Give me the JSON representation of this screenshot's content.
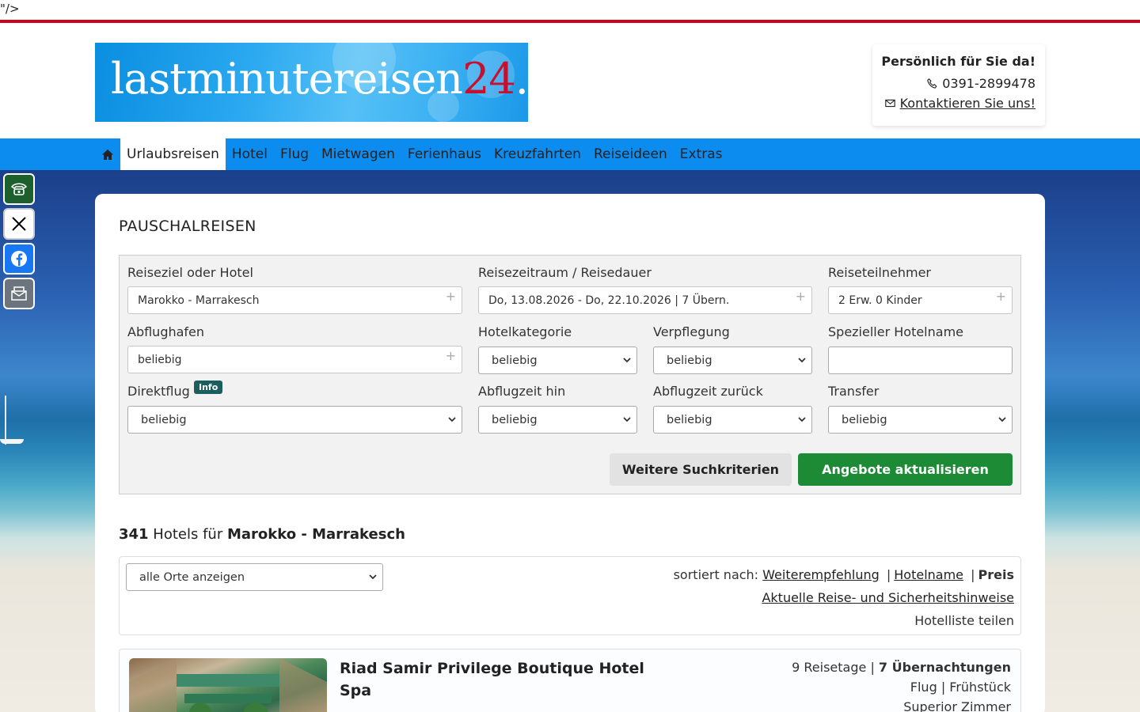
{
  "stray_text": "\"/>",
  "logo": {
    "text_main": "lastminutereisen",
    "text_accent": "24",
    "text_suffix": ".de"
  },
  "contact": {
    "title": "Persönlich für Sie da!",
    "phone": "0391-2899478",
    "contact_link": "Kontaktieren Sie uns!"
  },
  "nav": {
    "items": [
      {
        "label": "Urlaubsreisen ",
        "active": true
      },
      {
        "label": "Hotel "
      },
      {
        "label": "Flug "
      },
      {
        "label": "Mietwagen"
      },
      {
        "label": "Ferienhaus"
      },
      {
        "label": "Kreuzfahrten "
      },
      {
        "label": "Reiseideen"
      },
      {
        "label": "Extras "
      }
    ]
  },
  "search": {
    "title": "PAUSCHALREISEN",
    "destination_label": "Reiseziel oder Hotel",
    "destination_value": "Marokko - Marrakesch",
    "period_label": "Reisezeitraum / Reisedauer",
    "period_value": "Do, 13.08.2026 - Do, 22.10.2026 | 7 Übern.",
    "travelers_label": "Reiseteilnehmer",
    "travelers_value": "2 Erw. 0 Kinder",
    "airport_label": "Abflughafen",
    "airport_value": "beliebig",
    "category_label": "Hotelkategorie",
    "category_value": "beliebig",
    "board_label": "Verpflegung",
    "board_value": "beliebig",
    "hotelname_label": "Spezieller Hotelname",
    "hotelname_value": "",
    "direct_label": "Direktflug",
    "direct_info": "Info",
    "direct_value": "beliebig",
    "dep_time_label": "Abflugzeit hin",
    "dep_time_value": "beliebig",
    "ret_time_label": "Abflugzeit zurück",
    "ret_time_value": "beliebig",
    "transfer_label": "Transfer",
    "transfer_value": "beliebig",
    "more_button": "Weitere Suchkriterien",
    "update_button": "Angebote aktualisieren",
    "plus": "+"
  },
  "results": {
    "count": "341",
    "middle": " Hotels für ",
    "destination": "Marokko - Marrakesch",
    "location_filter": "alle Orte anzeigen",
    "sort_prefix": "sortiert nach:",
    "sort_recommend": "Weiterempfehlung",
    "sort_sep": "|",
    "sort_name": "Hotelname",
    "sort_price": "Preis",
    "safety_link": "Aktuelle Reise- und Sicherheitshinweise",
    "share_icon": "",
    "share_label": "Hotelliste teilen"
  },
  "hotel": {
    "name": "Riad Samir Privilege Boutique Hotel Spa",
    "stars": "",
    "days": "9 Reisetage",
    "sep": " | ",
    "nights": "7 Übernachtungen",
    "flight_board": "Flug | Frühstück",
    "room": "Superior Zimmer"
  },
  "colors": {
    "brand_red": "#d0021b",
    "nav_blue": "#0d8cf0",
    "cta_green": "#1d8a35"
  }
}
